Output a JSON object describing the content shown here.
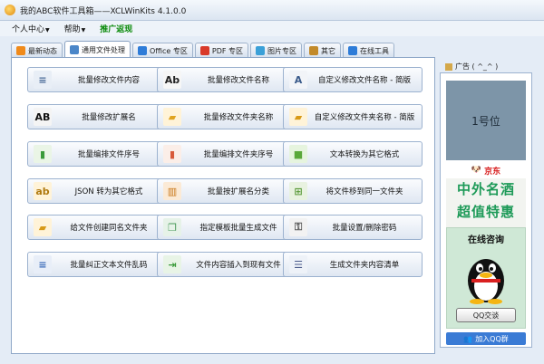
{
  "window": {
    "title": "我的ABC软件工具箱——XCLWinKits  4.1.0.0"
  },
  "menu": [
    {
      "label": "个人中心",
      "arrow": "▼"
    },
    {
      "label": "帮助",
      "arrow": "▼"
    },
    {
      "label": "推广返现",
      "arrow": ""
    }
  ],
  "tabs": [
    {
      "label": "最新动态",
      "color": "#f08a1a"
    },
    {
      "label": "通用文件处理",
      "color": "#4a86c8"
    },
    {
      "label": "Office 专区",
      "color": "#2e7cd8"
    },
    {
      "label": "PDF 专区",
      "color": "#d93a2a"
    },
    {
      "label": "图片专区",
      "color": "#3aa0d8"
    },
    {
      "label": "其它",
      "color": "#c28a2a"
    },
    {
      "label": "在线工具",
      "color": "#2e7cd8"
    }
  ],
  "buttons": [
    {
      "label": "批量修改文件内容",
      "icon": "document-edit-icon",
      "glyph": "≡",
      "bg": "#e8eef6",
      "fg": "#4a6a98"
    },
    {
      "label": "批量修改文件名称",
      "icon": "text-pen-icon",
      "glyph": "Ab",
      "bg": "#f6f6f6",
      "fg": "#222"
    },
    {
      "label": "自定义修改文件名称 - 简版",
      "icon": "letter-a-icon",
      "glyph": "A",
      "bg": "#f2f4f8",
      "fg": "#3a5a8a"
    },
    {
      "label": "批量修改扩展名",
      "icon": "ab-text-icon",
      "glyph": "AB",
      "bg": "#f4f4f4",
      "fg": "#111"
    },
    {
      "label": "批量修改文件夹名称",
      "icon": "folder-open-icon",
      "glyph": "▰",
      "bg": "#fff3d8",
      "fg": "#e0a420"
    },
    {
      "label": "自定义修改文件夹名称 - 简版",
      "icon": "folder-gear-icon",
      "glyph": "▰",
      "bg": "#fff3d8",
      "fg": "#d89a18"
    },
    {
      "label": "批量编排文件序号",
      "icon": "bar-chart-icon",
      "glyph": "▮",
      "bg": "#eaf5e6",
      "fg": "#3a9a3a"
    },
    {
      "label": "批量编排文件夹序号",
      "icon": "color-bars-icon",
      "glyph": "▮",
      "bg": "#fbeee8",
      "fg": "#d85a3a"
    },
    {
      "label": "文本转换为其它格式",
      "icon": "green-blocks-icon",
      "glyph": "■",
      "bg": "#e6f4de",
      "fg": "#5aa83a"
    },
    {
      "label": "JSON 转为其它格式",
      "icon": "ab-convert-icon",
      "glyph": "ab",
      "bg": "#fff3d8",
      "fg": "#b07a10"
    },
    {
      "label": "批量按扩展名分类",
      "icon": "books-icon",
      "glyph": "▥",
      "bg": "#fbead6",
      "fg": "#c8781a"
    },
    {
      "label": "将文件移到同一文件夹",
      "icon": "merge-tree-icon",
      "glyph": "⊞",
      "bg": "#e8f2e0",
      "fg": "#5a9a3a"
    },
    {
      "label": "给文件创建同名文件夹",
      "icon": "folder-doc-icon",
      "glyph": "▰",
      "bg": "#fff3d8",
      "fg": "#d89a18"
    },
    {
      "label": "指定模板批量生成文件",
      "icon": "template-copy-icon",
      "glyph": "❐",
      "bg": "#e6f2e8",
      "fg": "#4a9a5a"
    },
    {
      "label": "批量设置/删除密码",
      "icon": "lock-key-icon",
      "glyph": "⚿",
      "bg": "#f2f2f2",
      "fg": "#555"
    },
    {
      "label": "批量纠正文本文件乱码",
      "icon": "text-fix-icon",
      "glyph": "≡",
      "bg": "#e8eef8",
      "fg": "#3a6ab8"
    },
    {
      "label": "文件内容插入到现有文件",
      "icon": "doc-insert-icon",
      "glyph": "⇥",
      "bg": "#e8f4e6",
      "fg": "#3a9a3a"
    },
    {
      "label": "生成文件夹内容清单",
      "icon": "list-icon",
      "glyph": "☰",
      "bg": "#eef2f8",
      "fg": "#4a5a8a"
    }
  ],
  "ad": {
    "header": "广告 ( ^_^ )",
    "slot1": "1号位",
    "jd": "京东",
    "wine_line1": "中外名酒",
    "wine_line2": "超值特惠",
    "consult_title": "在线咨询",
    "qq_chat": "QQ交谈",
    "qq_group": "加入QQ群"
  }
}
